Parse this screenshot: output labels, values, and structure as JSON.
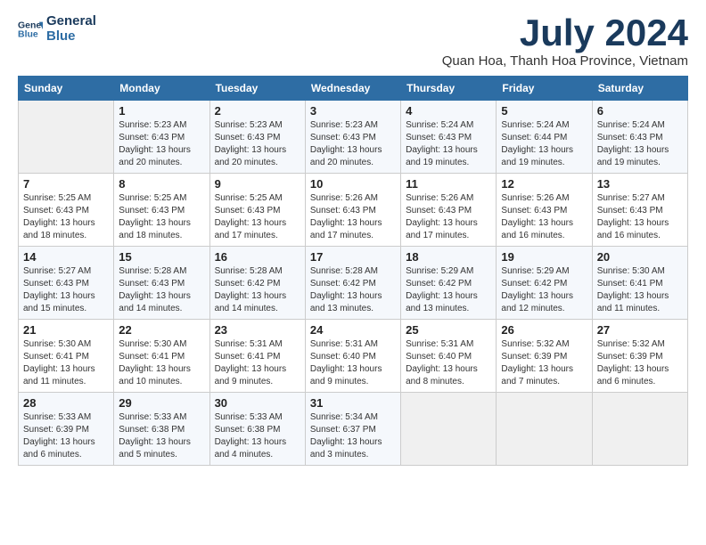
{
  "header": {
    "logo_line1": "General",
    "logo_line2": "Blue",
    "month": "July 2024",
    "location": "Quan Hoa, Thanh Hoa Province, Vietnam"
  },
  "days_of_week": [
    "Sunday",
    "Monday",
    "Tuesday",
    "Wednesday",
    "Thursday",
    "Friday",
    "Saturday"
  ],
  "weeks": [
    [
      {
        "day": "",
        "sunrise": "",
        "sunset": "",
        "daylight": ""
      },
      {
        "day": "1",
        "sunrise": "Sunrise: 5:23 AM",
        "sunset": "Sunset: 6:43 PM",
        "daylight": "Daylight: 13 hours and 20 minutes."
      },
      {
        "day": "2",
        "sunrise": "Sunrise: 5:23 AM",
        "sunset": "Sunset: 6:43 PM",
        "daylight": "Daylight: 13 hours and 20 minutes."
      },
      {
        "day": "3",
        "sunrise": "Sunrise: 5:23 AM",
        "sunset": "Sunset: 6:43 PM",
        "daylight": "Daylight: 13 hours and 20 minutes."
      },
      {
        "day": "4",
        "sunrise": "Sunrise: 5:24 AM",
        "sunset": "Sunset: 6:43 PM",
        "daylight": "Daylight: 13 hours and 19 minutes."
      },
      {
        "day": "5",
        "sunrise": "Sunrise: 5:24 AM",
        "sunset": "Sunset: 6:44 PM",
        "daylight": "Daylight: 13 hours and 19 minutes."
      },
      {
        "day": "6",
        "sunrise": "Sunrise: 5:24 AM",
        "sunset": "Sunset: 6:43 PM",
        "daylight": "Daylight: 13 hours and 19 minutes."
      }
    ],
    [
      {
        "day": "7",
        "sunrise": "Sunrise: 5:25 AM",
        "sunset": "Sunset: 6:43 PM",
        "daylight": "Daylight: 13 hours and 18 minutes."
      },
      {
        "day": "8",
        "sunrise": "Sunrise: 5:25 AM",
        "sunset": "Sunset: 6:43 PM",
        "daylight": "Daylight: 13 hours and 18 minutes."
      },
      {
        "day": "9",
        "sunrise": "Sunrise: 5:25 AM",
        "sunset": "Sunset: 6:43 PM",
        "daylight": "Daylight: 13 hours and 17 minutes."
      },
      {
        "day": "10",
        "sunrise": "Sunrise: 5:26 AM",
        "sunset": "Sunset: 6:43 PM",
        "daylight": "Daylight: 13 hours and 17 minutes."
      },
      {
        "day": "11",
        "sunrise": "Sunrise: 5:26 AM",
        "sunset": "Sunset: 6:43 PM",
        "daylight": "Daylight: 13 hours and 17 minutes."
      },
      {
        "day": "12",
        "sunrise": "Sunrise: 5:26 AM",
        "sunset": "Sunset: 6:43 PM",
        "daylight": "Daylight: 13 hours and 16 minutes."
      },
      {
        "day": "13",
        "sunrise": "Sunrise: 5:27 AM",
        "sunset": "Sunset: 6:43 PM",
        "daylight": "Daylight: 13 hours and 16 minutes."
      }
    ],
    [
      {
        "day": "14",
        "sunrise": "Sunrise: 5:27 AM",
        "sunset": "Sunset: 6:43 PM",
        "daylight": "Daylight: 13 hours and 15 minutes."
      },
      {
        "day": "15",
        "sunrise": "Sunrise: 5:28 AM",
        "sunset": "Sunset: 6:43 PM",
        "daylight": "Daylight: 13 hours and 14 minutes."
      },
      {
        "day": "16",
        "sunrise": "Sunrise: 5:28 AM",
        "sunset": "Sunset: 6:42 PM",
        "daylight": "Daylight: 13 hours and 14 minutes."
      },
      {
        "day": "17",
        "sunrise": "Sunrise: 5:28 AM",
        "sunset": "Sunset: 6:42 PM",
        "daylight": "Daylight: 13 hours and 13 minutes."
      },
      {
        "day": "18",
        "sunrise": "Sunrise: 5:29 AM",
        "sunset": "Sunset: 6:42 PM",
        "daylight": "Daylight: 13 hours and 13 minutes."
      },
      {
        "day": "19",
        "sunrise": "Sunrise: 5:29 AM",
        "sunset": "Sunset: 6:42 PM",
        "daylight": "Daylight: 13 hours and 12 minutes."
      },
      {
        "day": "20",
        "sunrise": "Sunrise: 5:30 AM",
        "sunset": "Sunset: 6:41 PM",
        "daylight": "Daylight: 13 hours and 11 minutes."
      }
    ],
    [
      {
        "day": "21",
        "sunrise": "Sunrise: 5:30 AM",
        "sunset": "Sunset: 6:41 PM",
        "daylight": "Daylight: 13 hours and 11 minutes."
      },
      {
        "day": "22",
        "sunrise": "Sunrise: 5:30 AM",
        "sunset": "Sunset: 6:41 PM",
        "daylight": "Daylight: 13 hours and 10 minutes."
      },
      {
        "day": "23",
        "sunrise": "Sunrise: 5:31 AM",
        "sunset": "Sunset: 6:41 PM",
        "daylight": "Daylight: 13 hours and 9 minutes."
      },
      {
        "day": "24",
        "sunrise": "Sunrise: 5:31 AM",
        "sunset": "Sunset: 6:40 PM",
        "daylight": "Daylight: 13 hours and 9 minutes."
      },
      {
        "day": "25",
        "sunrise": "Sunrise: 5:31 AM",
        "sunset": "Sunset: 6:40 PM",
        "daylight": "Daylight: 13 hours and 8 minutes."
      },
      {
        "day": "26",
        "sunrise": "Sunrise: 5:32 AM",
        "sunset": "Sunset: 6:39 PM",
        "daylight": "Daylight: 13 hours and 7 minutes."
      },
      {
        "day": "27",
        "sunrise": "Sunrise: 5:32 AM",
        "sunset": "Sunset: 6:39 PM",
        "daylight": "Daylight: 13 hours and 6 minutes."
      }
    ],
    [
      {
        "day": "28",
        "sunrise": "Sunrise: 5:33 AM",
        "sunset": "Sunset: 6:39 PM",
        "daylight": "Daylight: 13 hours and 6 minutes."
      },
      {
        "day": "29",
        "sunrise": "Sunrise: 5:33 AM",
        "sunset": "Sunset: 6:38 PM",
        "daylight": "Daylight: 13 hours and 5 minutes."
      },
      {
        "day": "30",
        "sunrise": "Sunrise: 5:33 AM",
        "sunset": "Sunset: 6:38 PM",
        "daylight": "Daylight: 13 hours and 4 minutes."
      },
      {
        "day": "31",
        "sunrise": "Sunrise: 5:34 AM",
        "sunset": "Sunset: 6:37 PM",
        "daylight": "Daylight: 13 hours and 3 minutes."
      },
      {
        "day": "",
        "sunrise": "",
        "sunset": "",
        "daylight": ""
      },
      {
        "day": "",
        "sunrise": "",
        "sunset": "",
        "daylight": ""
      },
      {
        "day": "",
        "sunrise": "",
        "sunset": "",
        "daylight": ""
      }
    ]
  ]
}
